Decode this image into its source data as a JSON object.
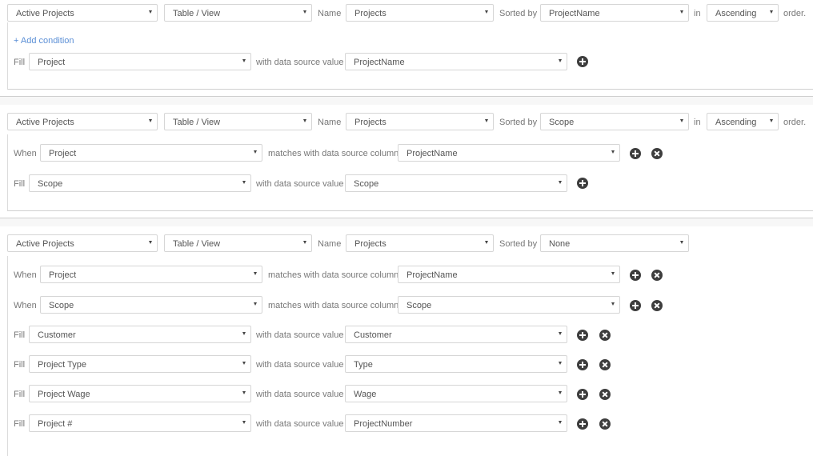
{
  "labels": {
    "name": "Name",
    "sorted_by": "Sorted by",
    "in": "in",
    "order": "order.",
    "fill": "Fill",
    "when": "When",
    "with_value": "with data source value",
    "matches_column": "matches with data source column",
    "add_condition": "+ Add condition"
  },
  "blocks": [
    {
      "source": "Active Projects",
      "type": "Table / View",
      "name": "Projects",
      "sorted_by": "ProjectName",
      "order": "Ascending",
      "conditions": [],
      "fills": [
        {
          "field": "Project",
          "value": "ProjectName"
        }
      ]
    },
    {
      "source": "Active Projects",
      "type": "Table / View",
      "name": "Projects",
      "sorted_by": "Scope",
      "order": "Ascending",
      "conditions": [
        {
          "field": "Project",
          "column": "ProjectName"
        }
      ],
      "fills": [
        {
          "field": "Scope",
          "value": "Scope"
        }
      ]
    },
    {
      "source": "Active Projects",
      "type": "Table / View",
      "name": "Projects",
      "sorted_by": "None",
      "conditions": [
        {
          "field": "Project",
          "column": "ProjectName"
        },
        {
          "field": "Scope",
          "column": "Scope"
        }
      ],
      "fills": [
        {
          "field": "Customer",
          "value": "Customer"
        },
        {
          "field": "Project Type",
          "value": "Type"
        },
        {
          "field": "Project Wage",
          "value": "Wage"
        },
        {
          "field": "Project #",
          "value": "ProjectNumber"
        }
      ]
    }
  ]
}
